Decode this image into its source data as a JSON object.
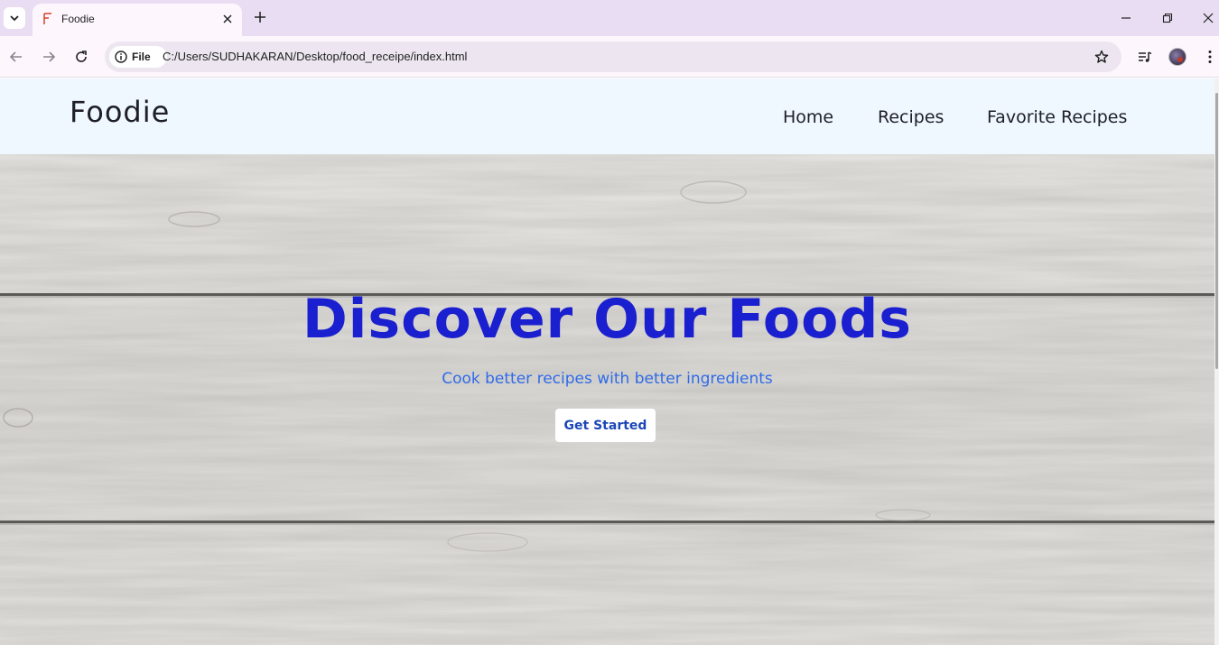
{
  "browser": {
    "tab_title": "Foodie",
    "address_chip": "File",
    "url": "C:/Users/SUDHAKARAN/Desktop/food_receipe/index.html",
    "icons": {
      "tab_search": "chevron-down-icon",
      "favicon": "foodie-favicon",
      "tab_close": "close-icon",
      "new_tab": "plus-icon",
      "minimize": "minimize-icon",
      "restore": "restore-icon",
      "close_window": "close-icon",
      "back": "arrow-left-icon",
      "forward": "arrow-right-icon",
      "reload": "reload-icon",
      "site_info": "info-icon",
      "bookmark": "star-icon",
      "media": "media-control-icon",
      "profile": "avatar",
      "menu": "kebab-menu-icon"
    }
  },
  "site": {
    "logo": "Foodie",
    "nav": {
      "home": "Home",
      "recipes": "Recipes",
      "favorites": "Favorite Recipes"
    }
  },
  "hero": {
    "title": "Discover Our Foods",
    "subtitle": "Cook better recipes with better ingredients",
    "cta_label": "Get Started"
  },
  "colors": {
    "tab_strip": "#e8ddf3",
    "toolbar": "#fdf7fd",
    "header_bg": "#eff7ff",
    "hero_title": "#1a1fcf",
    "hero_subtitle": "#2f6be8",
    "cta_text": "#1c47b8",
    "wood_base": "#dcdad6"
  }
}
